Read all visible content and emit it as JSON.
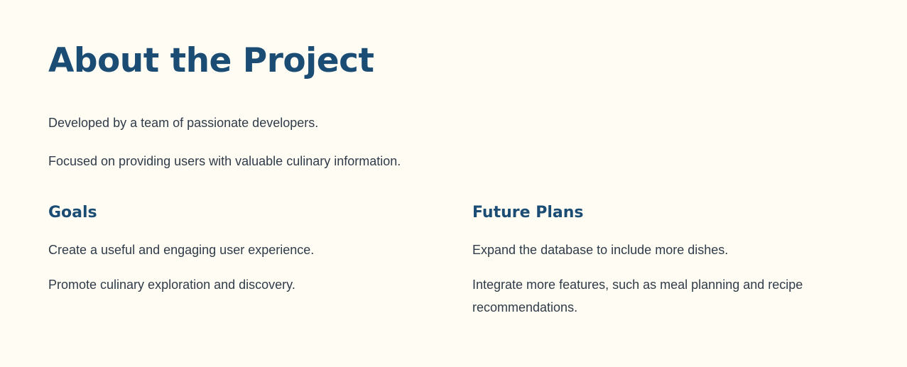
{
  "page": {
    "title": "About the Project",
    "intro": [
      "Developed by a team of passionate developers.",
      "Focused on providing users with valuable culinary information."
    ]
  },
  "goals": {
    "title": "Goals",
    "items": [
      "Create a useful and engaging user experience.",
      "Promote culinary exploration and discovery."
    ]
  },
  "future_plans": {
    "title": "Future Plans",
    "items": [
      "Expand the database to include more dishes.",
      "Integrate more features, such as meal planning and recipe recommendations."
    ]
  },
  "colors": {
    "background": "#fffcf4",
    "heading": "#1b4d74",
    "body_text": "#2f3b48"
  }
}
